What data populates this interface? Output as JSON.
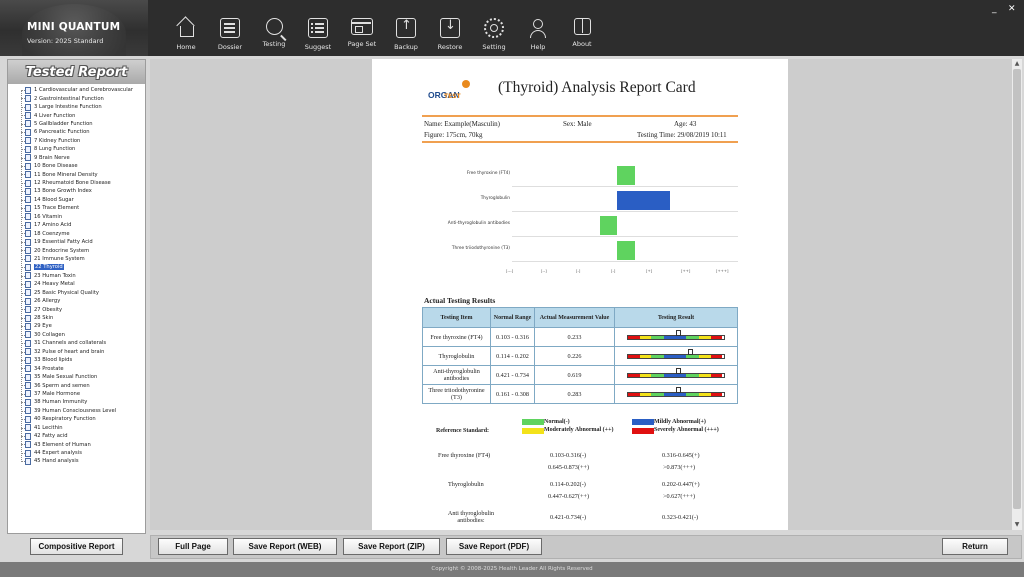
{
  "app": {
    "name": "MINI QUANTUM",
    "version": "Version: 2025 Standard",
    "min_label": "_",
    "close_label": "✕"
  },
  "nav": [
    {
      "label": "Home",
      "icon": "home-icon"
    },
    {
      "label": "Dossier",
      "icon": "dossier-icon"
    },
    {
      "label": "Testing",
      "icon": "testing-icon"
    },
    {
      "label": "Suggest",
      "icon": "suggest-icon"
    },
    {
      "label": "Page Set",
      "icon": "page-set-icon"
    },
    {
      "label": "Backup",
      "icon": "backup-icon"
    },
    {
      "label": "Restore",
      "icon": "restore-icon"
    },
    {
      "label": "Setting",
      "icon": "setting-icon"
    },
    {
      "label": "Help",
      "icon": "help-icon"
    },
    {
      "label": "About",
      "icon": "about-icon"
    }
  ],
  "sidebar": {
    "title": "Tested Report",
    "selected_index": 21,
    "items": [
      "1 Cardiovascular and Cerebrovascular",
      "2 Gastrointestinal Function",
      "3 Large Intestine Function",
      "4 Liver Function",
      "5 Gallbladder Function",
      "6 Pancreatic Function",
      "7 Kidney Function",
      "8 Lung Function",
      "9 Brain Nerve",
      "10 Bone Disease",
      "11 Bone Mineral Density",
      "12 Rheumatoid Bone Disease",
      "13 Bone Growth Index",
      "14 Blood Sugar",
      "15 Trace Element",
      "16 Vitamin",
      "17 Amino Acid",
      "18 Coenzyme",
      "19 Essential Fatty Acid",
      "20 Endocrine System",
      "21 Immune System",
      "22 Thyroid",
      "23 Human Toxin",
      "24 Heavy Metal",
      "25 Basic Physical Quality",
      "26 Allergy",
      "27 Obesity",
      "28 Skin",
      "29 Eye",
      "30 Collagen",
      "31 Channels and collaterals",
      "32 Pulse of heart and brain",
      "33 Blood lipids",
      "34 Prostate",
      "35 Male Sexual Function",
      "36 Sperm and semen",
      "37 Male Hormone",
      "38 Human Immunity",
      "39 Human Consciousness Level",
      "40 Respiratory Function",
      "41 Lecithin",
      "42 Fatty acid",
      "43 Element of Human",
      "44 Expert analysis",
      "45 Hand analysis"
    ]
  },
  "report": {
    "logo_text": "ORGAN",
    "logo_sub": "TEST",
    "title": "(Thyroid) Analysis Report Card",
    "name": "Name: Example(Masculin)",
    "sex": "Sex: Male",
    "age": "Age: 43",
    "figure": "Figure: 175cm, 70kg",
    "testing_time": "Testing Time: 29/08/2019 10:11",
    "section_title": "Actual Testing Results",
    "table_headers": [
      "Testing Item",
      "Normal Range",
      "Actual Measurement Value",
      "Testing Result"
    ],
    "rows": [
      {
        "item": "Free thyroxine (FT4)",
        "range": "0.103 - 0.316",
        "value": "0.233",
        "level": 0.5
      },
      {
        "item": "Thyroglobulin",
        "range": "0.114 - 0.202",
        "value": "0.226",
        "level": 0.63
      },
      {
        "item": "Anti-thyroglobulin antibodies",
        "range": "0.421 - 0.734",
        "value": "0.619",
        "level": 0.5
      },
      {
        "item": "Three triiodothyronine (T3)",
        "range": "0.161 - 0.308",
        "value": "0.283",
        "level": 0.5
      }
    ],
    "legend": {
      "label": "Reference Standard:",
      "normal": "Normal(-)",
      "moderately": "Moderately Abnormal (++)",
      "mildly": "Mildly Abnormal(+)",
      "severely": "Severely Abnormal (+++)"
    },
    "reference": [
      {
        "item": "Free thyroxine (FT4)",
        "c1a": "0.103-0.316(-)",
        "c2a": "0.316-0.645(+)",
        "c1b": "0.645-0.873(++)",
        "c2b": ">0.873(+++)"
      },
      {
        "item": "Thyroglobulin",
        "c1a": "0.114-0.202(-)",
        "c2a": "0.202-0.447(+)",
        "c1b": "0.447-0.627(++)",
        "c2b": ">0.627(+++)"
      },
      {
        "item": "Anti thyroglobulin antibodies:",
        "c1a": "0.421-0.734(-)",
        "c2a": "0.323-0.421(-)",
        "c1b": "",
        "c2b": ""
      }
    ]
  },
  "chart_data": {
    "type": "bar",
    "orientation": "horizontal",
    "categories": [
      "Free thyroxine (FT4)",
      "Thyroglobulin",
      "Anti-thyroglobulin antibodies",
      "Three triiodothyronine (T3)"
    ],
    "tick_labels": [
      "[---]",
      "[--]",
      "[-]",
      "[-]",
      "[+]",
      "[++]",
      "[+++]"
    ],
    "bars": [
      {
        "start": 3.0,
        "end": 3.5,
        "color": "#5fd35f"
      },
      {
        "start": 3.0,
        "end": 4.5,
        "color": "#2a5ec4"
      },
      {
        "start": 2.5,
        "end": 3.0,
        "color": "#5fd35f"
      },
      {
        "start": 3.0,
        "end": 3.5,
        "color": "#5fd35f"
      }
    ],
    "xlim": [
      0,
      6
    ],
    "grid": true
  },
  "buttons": {
    "compositive": "Compositive Report",
    "full_page": "Full Page",
    "save_web": "Save Report (WEB)",
    "save_zip": "Save Report (ZIP)",
    "save_pdf": "Save Report (PDF)",
    "return": "Return"
  },
  "footer": {
    "copyright": "Copyright © 2008-2025 Health Leader All Rights Reserved"
  },
  "colors": {
    "gauge": [
      "#e01010",
      "#f3e21a",
      "#5fd35f",
      "#2a5ec4",
      "#5fd35f",
      "#f3e21a",
      "#e01010"
    ],
    "normal": "#5fd35f",
    "moderately": "#f3e21a",
    "mildly": "#2a5ec4",
    "severely": "#e01010"
  }
}
